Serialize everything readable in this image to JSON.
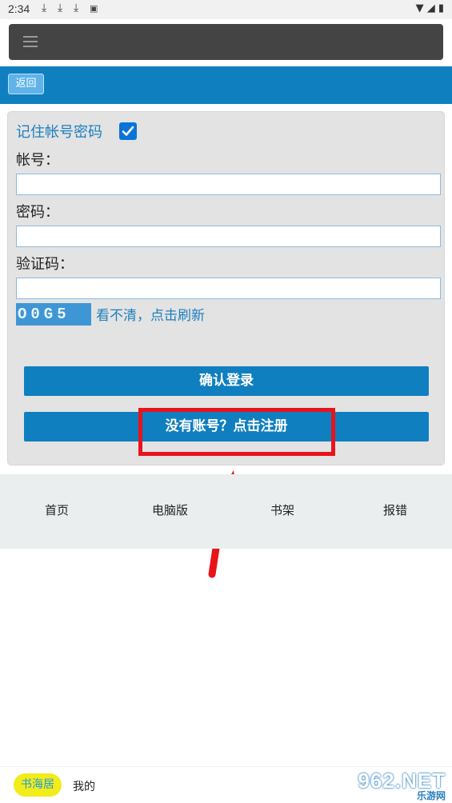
{
  "status_bar": {
    "time": "2:34",
    "icons": [
      "download-icon",
      "download-icon",
      "download-icon",
      "notification-icon",
      "wifi-icon",
      "signal-icon",
      "battery-icon"
    ]
  },
  "header": {
    "menu_icon": "hamburger-icon"
  },
  "nav": {
    "back_label": "返回"
  },
  "login_form": {
    "remember_label": "记住帐号密码",
    "remember_checked": true,
    "account_label": "帐号：",
    "account_value": "",
    "password_label": "密码：",
    "password_value": "",
    "captcha_label": "验证码：",
    "captcha_value": "",
    "captcha_image_text": "O0G5",
    "refresh_label": "看不清，点击刷新",
    "login_button": "确认登录",
    "register_button": "没有账号？点击注册"
  },
  "annotation": {
    "highlight_color": "#e8141b",
    "arrow_color": "#e8141b"
  },
  "footer_nav": {
    "items": [
      "首页",
      "电脑版",
      "书架",
      "报错"
    ]
  },
  "bottom_bar": {
    "app_badge": "书海居",
    "mine_label": "我的"
  },
  "watermark": {
    "brand": "962.NET",
    "sub": "乐游网"
  },
  "colors": {
    "accent": "#0f7fbf",
    "link": "#1d7fbf",
    "topbar": "#444444"
  }
}
